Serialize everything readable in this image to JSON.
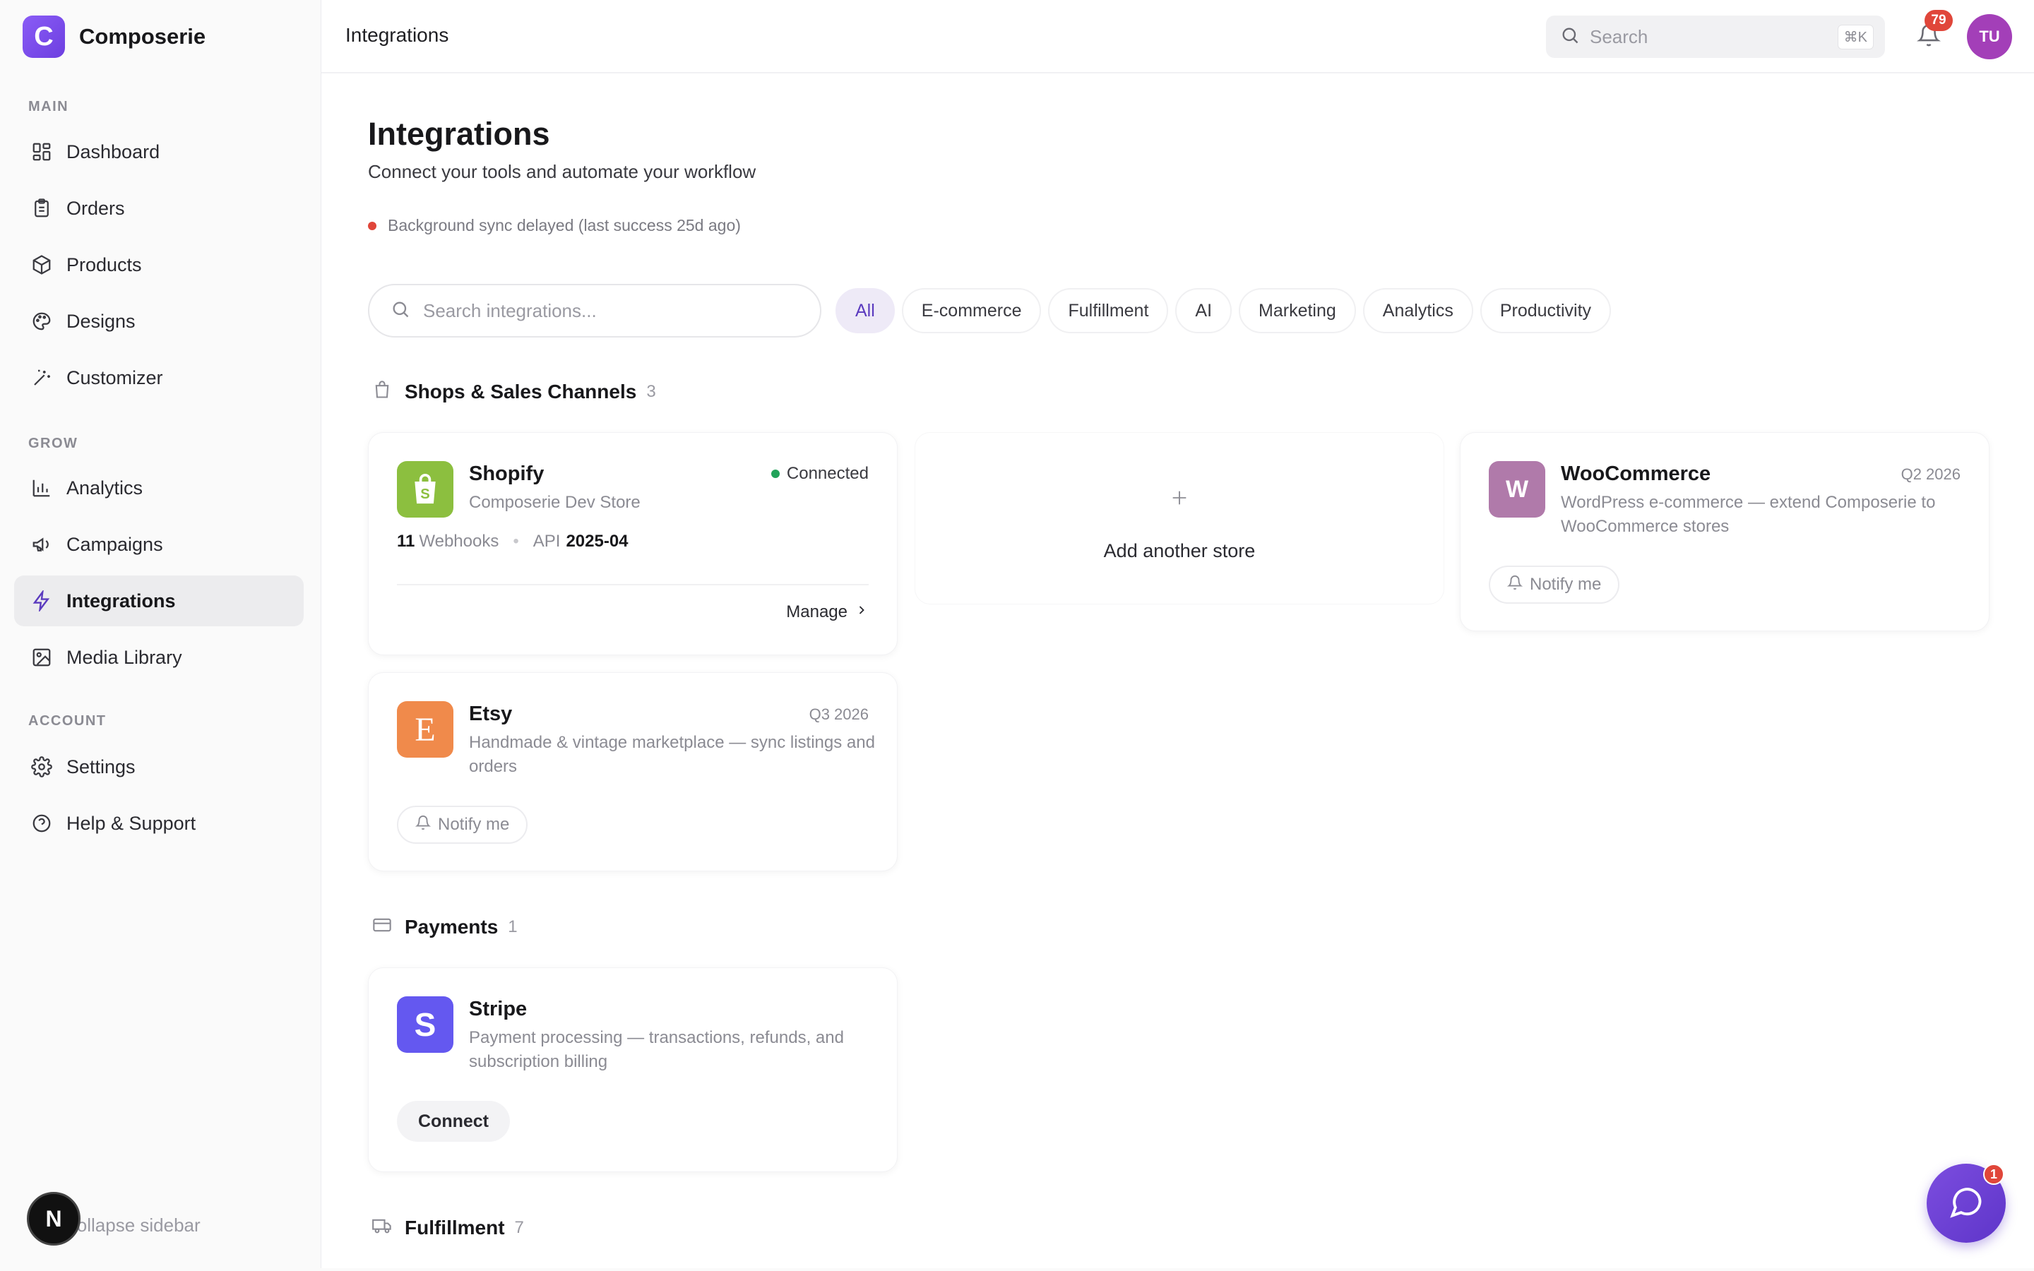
{
  "brand": {
    "logo_letter": "C",
    "name": "Composerie"
  },
  "sidebar": {
    "sections": [
      {
        "label": "MAIN"
      },
      {
        "label": "GROW"
      },
      {
        "label": "ACCOUNT"
      }
    ],
    "items": [
      {
        "label": "Dashboard",
        "icon": "dashboard-icon"
      },
      {
        "label": "Orders",
        "icon": "clipboard-icon"
      },
      {
        "label": "Products",
        "icon": "box-icon"
      },
      {
        "label": "Designs",
        "icon": "palette-icon"
      },
      {
        "label": "Customizer",
        "icon": "magic-wand-icon"
      },
      {
        "label": "Analytics",
        "icon": "bar-chart-icon"
      },
      {
        "label": "Campaigns",
        "icon": "megaphone-icon"
      },
      {
        "label": "Integrations",
        "icon": "lightning-icon",
        "active": true
      },
      {
        "label": "Media Library",
        "icon": "image-icon"
      },
      {
        "label": "Settings",
        "icon": "gear-icon"
      },
      {
        "label": "Help & Support",
        "icon": "help-circle-icon"
      }
    ],
    "collapse_label": "Collapse sidebar",
    "n_badge": "N"
  },
  "topbar": {
    "title": "Integrations",
    "search_placeholder": "Search",
    "shortcut": "⌘K",
    "notification_count": "79",
    "avatar_initials": "TU"
  },
  "page": {
    "title": "Integrations",
    "subtitle": "Connect your tools and automate your workflow",
    "status": "Background sync delayed (last success 25d ago)",
    "search_placeholder": "Search integrations...",
    "filters": [
      "All",
      "E-commerce",
      "Fulfillment",
      "AI",
      "Marketing",
      "Analytics",
      "Productivity"
    ],
    "active_filter": "All"
  },
  "sections": {
    "shops": {
      "title": "Shops & Sales Channels",
      "count": "3"
    },
    "payments": {
      "title": "Payments",
      "count": "1"
    },
    "fulfillment": {
      "title": "Fulfillment",
      "count": "7"
    }
  },
  "cards": {
    "shopify": {
      "name": "Shopify",
      "store": "Composerie Dev Store",
      "status": "Connected",
      "webhooks_count": "11",
      "webhooks_label": "Webhooks",
      "api_label": "API",
      "api_version": "2025-04",
      "manage_label": "Manage",
      "logo_color": "#8cbf3f"
    },
    "add_store": {
      "label": "Add another store"
    },
    "woocommerce": {
      "name": "WooCommerce",
      "tag": "Q2 2026",
      "logo_letter": "W",
      "desc": "WordPress e-commerce — extend Composerie to WooCommerce stores",
      "notify_label": "Notify me",
      "logo_color": "#b07aaa"
    },
    "etsy": {
      "name": "Etsy",
      "tag": "Q3 2026",
      "logo_letter": "E",
      "desc": "Handmade & vintage marketplace — sync listings and orders",
      "notify_label": "Notify me",
      "logo_color": "#f08a4b"
    },
    "stripe": {
      "name": "Stripe",
      "logo_letter": "S",
      "desc": "Payment processing — transactions, refunds, and subscription billing",
      "connect_label": "Connect",
      "logo_color": "#6458f0"
    }
  },
  "chat": {
    "unread": "1"
  }
}
